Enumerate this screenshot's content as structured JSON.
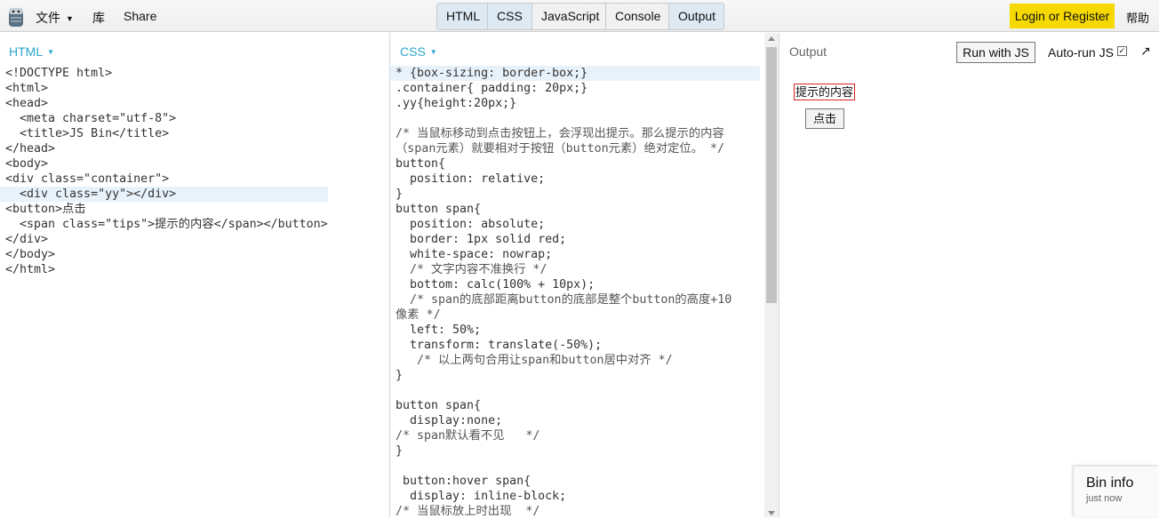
{
  "topbar": {
    "file_label": "文件",
    "library_label": "库",
    "share_label": "Share",
    "tabs": [
      {
        "label": "HTML",
        "active": true
      },
      {
        "label": "CSS",
        "active": true
      },
      {
        "label": "JavaScript",
        "active": false
      },
      {
        "label": "Console",
        "active": false
      },
      {
        "label": "Output",
        "active": true
      }
    ],
    "login_label": "Login or Register",
    "help_label": "帮助",
    "login_color": "#f5d900"
  },
  "html_panel": {
    "label": "HTML",
    "lines": [
      "<!DOCTYPE html>",
      "<html>",
      "<head>",
      "  <meta charset=\"utf-8\">",
      "  <title>JS Bin</title>",
      "</head>",
      "<body>",
      "<div class=\"container\">",
      "  <div class=\"yy\"></div>",
      "<button>点击",
      "  <span class=\"tips\">提示的内容</span></button>",
      "</div>",
      "</body>",
      "</html>"
    ]
  },
  "css_panel": {
    "label": "CSS",
    "lines": [
      "* {box-sizing: border-box;}",
      ".container{ padding: 20px;}",
      ".yy{height:20px;}",
      "",
      "/* 当鼠标移动到点击按钮上，会浮现出提示。那么提示的内容",
      "（span元素）就要相对于按钮（button元素）绝对定位。 */",
      "button{",
      "  position: relative;",
      "}",
      "button span{",
      "  position: absolute;",
      "  border: 1px solid red;",
      "  white-space: nowrap;",
      "  /* 文字内容不准换行 */",
      "  bottom: calc(100% + 10px);",
      "  /* span的底部距离button的底部是整个button的高度+10",
      "像素 */",
      "  left: 50%;",
      "  transform: translate(-50%);",
      "   /* 以上两句合用让span和button居中对齐 */",
      "}",
      "",
      "button span{",
      "  display:none;",
      "/* span默认看不见   */",
      "}",
      "",
      " button:hover span{",
      "  display: inline-block;",
      "/* 当鼠标放上时出现  */"
    ]
  },
  "output_panel": {
    "label": "Output",
    "run_label": "Run with JS",
    "autorun_label": "Auto-run JS",
    "autorun_checked": true,
    "expand_icon": "expand-arrow-icon",
    "tip_text": "提示的内容",
    "button_text": "点击",
    "tip_border_color": "#dd2222"
  },
  "bin_info": {
    "title": "Bin info",
    "subtitle": "just now"
  }
}
